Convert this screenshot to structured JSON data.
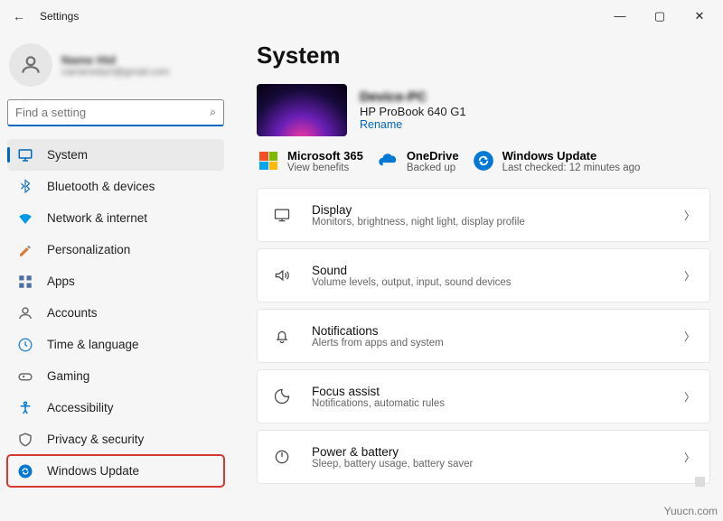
{
  "titlebar": {
    "title": "Settings"
  },
  "profile": {
    "name": "Name Hid",
    "email": "nameredact@gmail.com"
  },
  "search": {
    "placeholder": "Find a setting"
  },
  "sidebar": {
    "items": [
      {
        "label": "System"
      },
      {
        "label": "Bluetooth & devices"
      },
      {
        "label": "Network & internet"
      },
      {
        "label": "Personalization"
      },
      {
        "label": "Apps"
      },
      {
        "label": "Accounts"
      },
      {
        "label": "Time & language"
      },
      {
        "label": "Gaming"
      },
      {
        "label": "Accessibility"
      },
      {
        "label": "Privacy & security"
      },
      {
        "label": "Windows Update"
      }
    ]
  },
  "main": {
    "title": "System",
    "device": {
      "name": "Device-PC",
      "model": "HP ProBook 640 G1",
      "rename": "Rename"
    },
    "tiles": {
      "m365": {
        "label": "Microsoft 365",
        "sub": "View benefits"
      },
      "onedrive": {
        "label": "OneDrive",
        "sub": "Backed up"
      },
      "update": {
        "label": "Windows Update",
        "sub": "Last checked: 12 minutes ago"
      }
    },
    "cards": [
      {
        "title": "Display",
        "desc": "Monitors, brightness, night light, display profile"
      },
      {
        "title": "Sound",
        "desc": "Volume levels, output, input, sound devices"
      },
      {
        "title": "Notifications",
        "desc": "Alerts from apps and system"
      },
      {
        "title": "Focus assist",
        "desc": "Notifications, automatic rules"
      },
      {
        "title": "Power & battery",
        "desc": "Sleep, battery usage, battery saver"
      }
    ]
  },
  "watermark": "Yuucn.com"
}
